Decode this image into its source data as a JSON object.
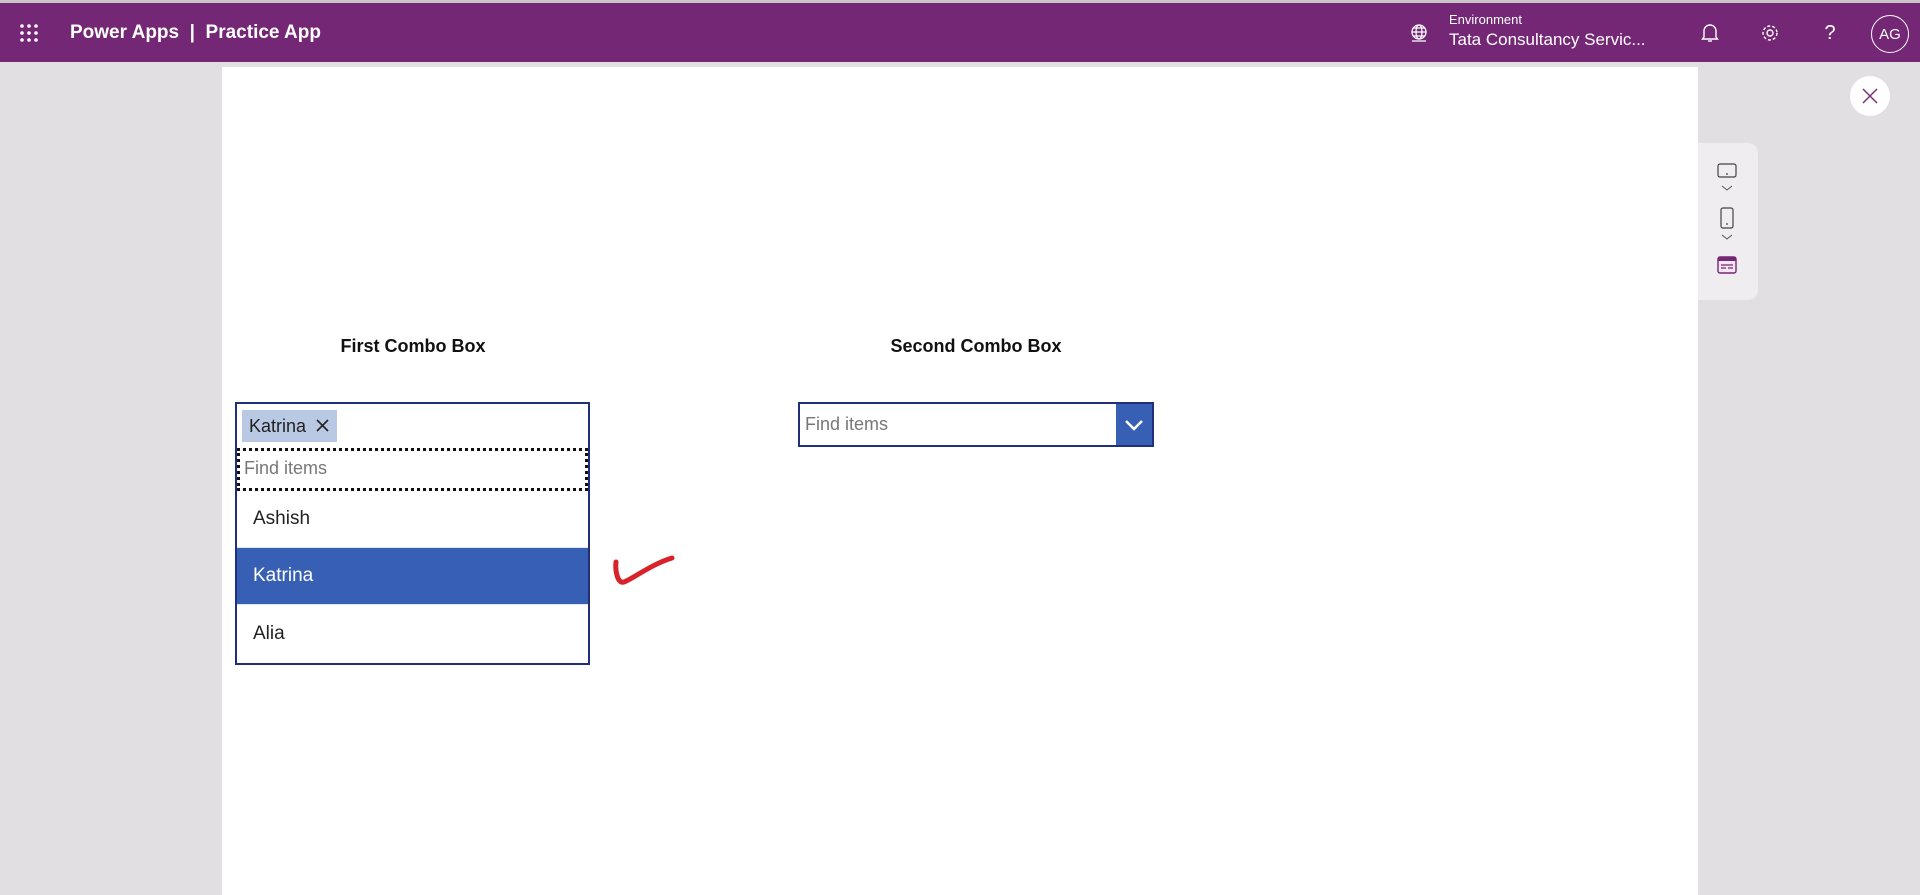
{
  "header": {
    "app_name": "Power Apps",
    "separator": "|",
    "app_title": "Practice App",
    "environment_label": "Environment",
    "environment_value": "Tata Consultancy Servic...",
    "avatar_initials": "AG",
    "help_glyph": "?",
    "brand_color": "#742774"
  },
  "canvas": {
    "first": {
      "label": "First Combo Box",
      "selected_tag": "Katrina",
      "search_placeholder": "Find items",
      "options": [
        {
          "label": "Ashish",
          "selected": false
        },
        {
          "label": "Katrina",
          "selected": true
        },
        {
          "label": "Alia",
          "selected": false
        }
      ],
      "selection_color": "#3760b4"
    },
    "second": {
      "label": "Second Combo Box",
      "search_placeholder": "Find items"
    }
  },
  "annotation": {
    "mark": "red-checkmark",
    "color": "#d9222a"
  }
}
